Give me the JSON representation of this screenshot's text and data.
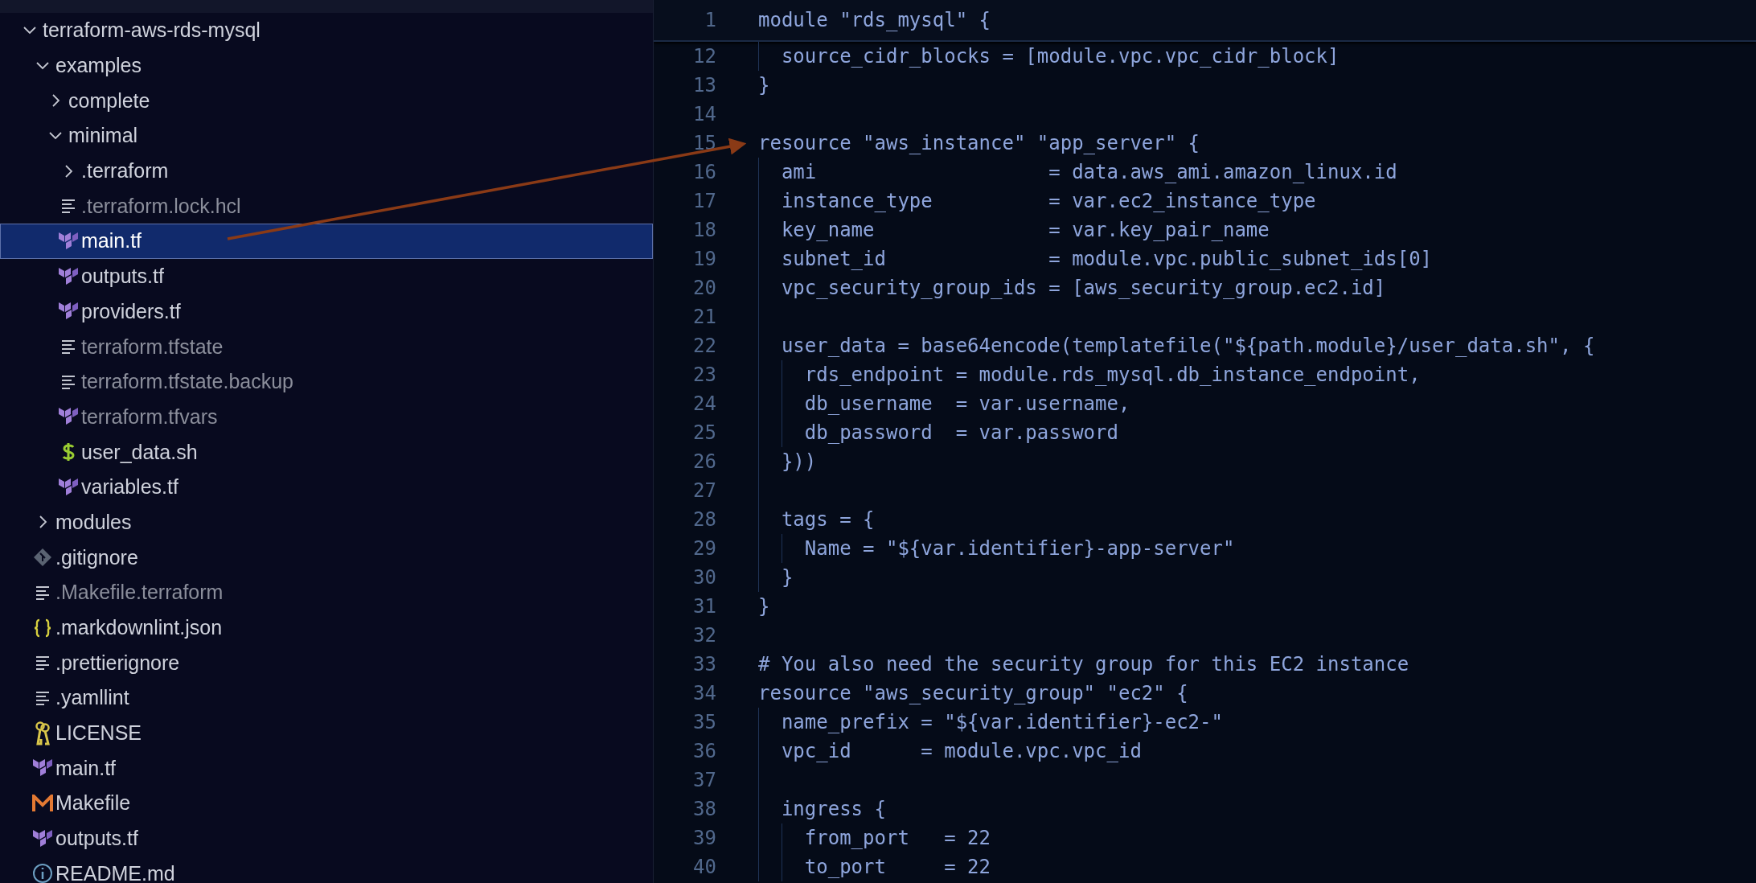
{
  "explorer": {
    "tree": [
      {
        "name": "terraform-aws-rds-mysql",
        "kind": "folder",
        "expanded": true,
        "selected": false,
        "children": [
          {
            "name": "examples",
            "kind": "folder",
            "expanded": true,
            "selected": false,
            "children": [
              {
                "name": "complete",
                "kind": "folder",
                "expanded": false,
                "selected": false
              },
              {
                "name": "minimal",
                "kind": "folder",
                "expanded": true,
                "selected": false,
                "children": [
                  {
                    "name": ".terraform",
                    "kind": "folder",
                    "expanded": false,
                    "selected": false
                  },
                  {
                    "name": ".terraform.lock.hcl",
                    "kind": "text",
                    "dimmed": true,
                    "selected": false
                  },
                  {
                    "name": "main.tf",
                    "kind": "terraform",
                    "dimmed": false,
                    "selected": true
                  },
                  {
                    "name": "outputs.tf",
                    "kind": "terraform",
                    "dimmed": false,
                    "selected": false
                  },
                  {
                    "name": "providers.tf",
                    "kind": "terraform",
                    "dimmed": false,
                    "selected": false
                  },
                  {
                    "name": "terraform.tfstate",
                    "kind": "text",
                    "dimmed": true,
                    "selected": false
                  },
                  {
                    "name": "terraform.tfstate.backup",
                    "kind": "text",
                    "dimmed": true,
                    "selected": false
                  },
                  {
                    "name": "terraform.tfvars",
                    "kind": "terraform",
                    "dimmed": true,
                    "selected": false
                  },
                  {
                    "name": "user_data.sh",
                    "kind": "shell",
                    "dimmed": false,
                    "selected": false
                  },
                  {
                    "name": "variables.tf",
                    "kind": "terraform",
                    "dimmed": false,
                    "selected": false
                  }
                ]
              }
            ]
          },
          {
            "name": "modules",
            "kind": "folder",
            "expanded": false,
            "selected": false
          },
          {
            "name": ".gitignore",
            "kind": "git",
            "dimmed": false,
            "selected": false
          },
          {
            "name": ".Makefile.terraform",
            "kind": "text",
            "dimmed": true,
            "selected": false
          },
          {
            "name": ".markdownlint.json",
            "kind": "json",
            "dimmed": false,
            "selected": false
          },
          {
            "name": ".prettierignore",
            "kind": "text",
            "dimmed": false,
            "selected": false
          },
          {
            "name": ".yamllint",
            "kind": "text",
            "dimmed": false,
            "selected": false
          },
          {
            "name": "LICENSE",
            "kind": "license",
            "dimmed": false,
            "selected": false
          },
          {
            "name": "main.tf",
            "kind": "terraform",
            "dimmed": false,
            "selected": false
          },
          {
            "name": "Makefile",
            "kind": "makefile",
            "dimmed": false,
            "selected": false
          },
          {
            "name": "outputs.tf",
            "kind": "terraform",
            "dimmed": false,
            "selected": false
          },
          {
            "name": "README.md",
            "kind": "readme",
            "dimmed": false,
            "selected": false
          }
        ]
      }
    ]
  },
  "editor": {
    "sticky_line": {
      "number": "1",
      "text": "module \"rds_mysql\" {"
    },
    "lines": [
      {
        "number": "12",
        "text": "  source_cidr_blocks = [module.vpc.vpc_cidr_block]"
      },
      {
        "number": "13",
        "text": "}"
      },
      {
        "number": "14"
      },
      {
        "number": "15",
        "text": "resource \"aws_instance\" \"app_server\" {"
      },
      {
        "number": "16",
        "text": "  ami                    = data.aws_ami.amazon_linux.id"
      },
      {
        "number": "17",
        "text": "  instance_type          = var.ec2_instance_type"
      },
      {
        "number": "18",
        "text": "  key_name               = var.key_pair_name"
      },
      {
        "number": "19",
        "text": "  subnet_id              = module.vpc.public_subnet_ids[0]"
      },
      {
        "number": "20",
        "text": "  vpc_security_group_ids = [aws_security_group.ec2.id]"
      },
      {
        "number": "21"
      },
      {
        "number": "22",
        "text": "  user_data = base64encode(templatefile(\"${path.module}/user_data.sh\", {"
      },
      {
        "number": "23",
        "text": "    rds_endpoint = module.rds_mysql.db_instance_endpoint,"
      },
      {
        "number": "24",
        "text": "    db_username  = var.username,"
      },
      {
        "number": "25",
        "text": "    db_password  = var.password"
      },
      {
        "number": "26",
        "text": "  }))"
      },
      {
        "number": "27"
      },
      {
        "number": "28",
        "text": "  tags = {"
      },
      {
        "number": "29",
        "text": "    Name = \"${var.identifier}-app-server\""
      },
      {
        "number": "30",
        "text": "  }"
      },
      {
        "number": "31",
        "text": "}"
      },
      {
        "number": "32"
      },
      {
        "number": "33",
        "text": "# You also need the security group for this EC2 instance"
      },
      {
        "number": "34",
        "text": "resource \"aws_security_group\" \"ec2\" {"
      },
      {
        "number": "35",
        "text": "  name_prefix = \"${var.identifier}-ec2-\""
      },
      {
        "number": "36",
        "text": "  vpc_id      = module.vpc.vpc_id"
      },
      {
        "number": "37"
      },
      {
        "number": "38",
        "text": "  ingress {"
      },
      {
        "number": "39",
        "text": "    from_port   = 22"
      },
      {
        "number": "40",
        "text": "    to_port     = 22"
      }
    ]
  }
}
